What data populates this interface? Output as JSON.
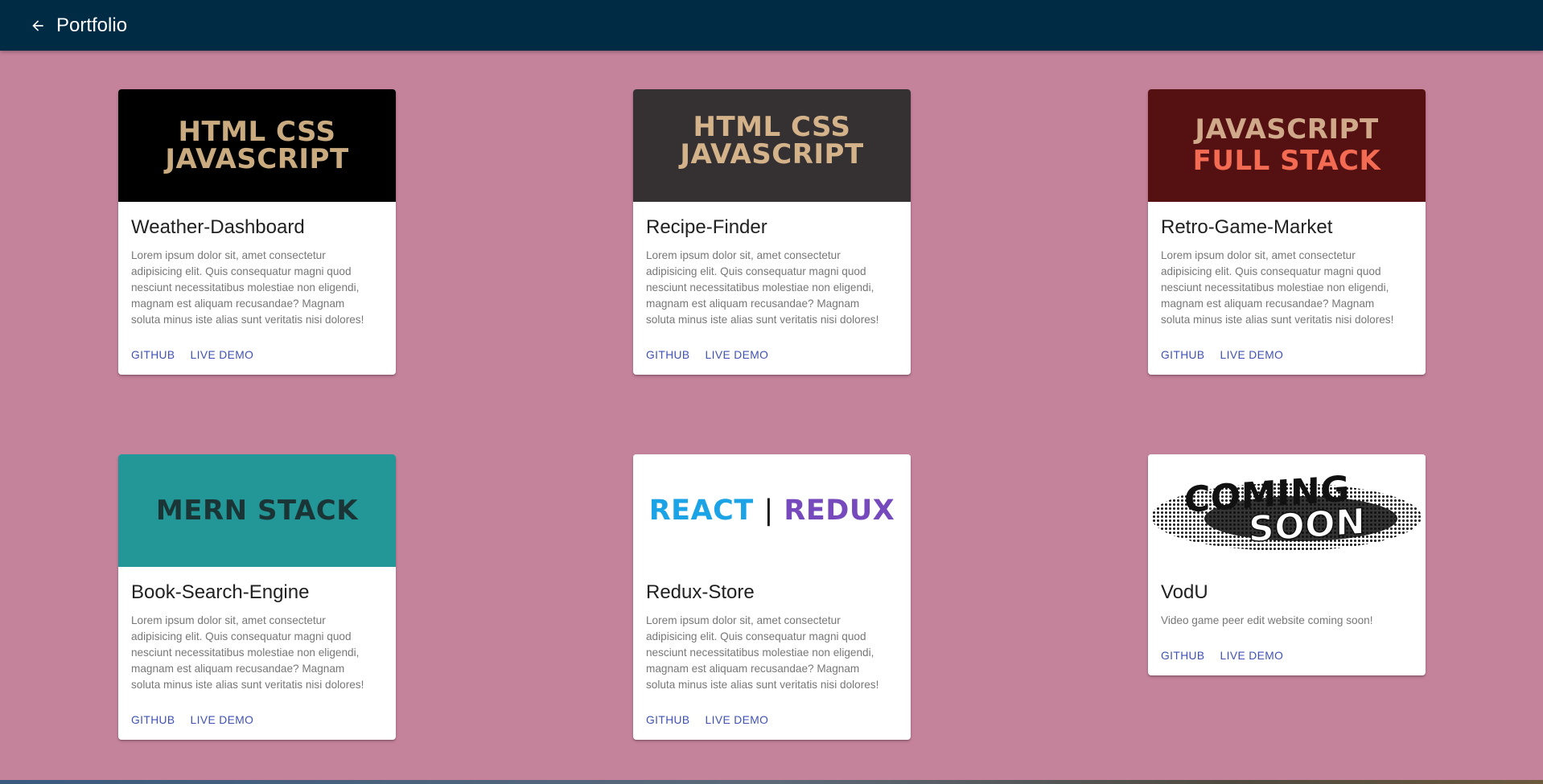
{
  "appbar": {
    "title": "Portfolio",
    "back_icon": "arrow-left-icon",
    "background": "#002b45"
  },
  "page": {
    "background": "#c5829b"
  },
  "actions": {
    "github_label": "GITHUB",
    "demo_label": "LIVE DEMO",
    "color": "#3f51b5"
  },
  "cards": [
    {
      "title": "Weather-Dashboard",
      "image_lines": [
        "HTML CSS",
        "JAVASCRIPT"
      ],
      "image_bg": "#000000",
      "image_fg": "#c9ab7f",
      "description": "Lorem ipsum dolor sit, amet consectetur\nadipisicing elit. Quis consequatur magni quod\nnesciunt necessitatibus molestiae non eligendi,\nmagnam est aliquam recusandae? Magnam\nsoluta minus iste alias sunt veritatis nisi dolores!"
    },
    {
      "title": "Recipe-Finder",
      "image_lines": [
        "HTML CSS",
        "JAVASCRIPT"
      ],
      "image_bg": "#353132",
      "image_fg": "#d4b38a",
      "description": "Lorem ipsum dolor sit, amet consectetur\nadipisicing elit. Quis consequatur magni quod\nnesciunt necessitatibus molestiae non eligendi,\nmagnam est aliquam recusandae? Magnam\nsoluta minus iste alias sunt veritatis nisi dolores!"
    },
    {
      "title": "Retro-Game-Market",
      "image_lines": [
        "JAVASCRIPT",
        "FULL STACK"
      ],
      "image_bg": "#551012",
      "image_fg": "#d0a98a",
      "image_fg2": "#f36b52",
      "description": "Lorem ipsum dolor sit, amet consectetur\nadipisicing elit. Quis consequatur magni quod\nnesciunt necessitatibus molestiae non eligendi,\nmagnam est aliquam recusandae? Magnam\nsoluta minus iste alias sunt veritatis nisi dolores!"
    },
    {
      "title": "Book-Search-Engine",
      "image_lines": [
        "MERN STACK"
      ],
      "image_bg": "#239797",
      "image_fg": "#1b3536",
      "description": "Lorem ipsum dolor sit, amet consectetur\nadipisicing elit. Quis consequatur magni quod\nnesciunt necessitatibus molestiae non eligendi,\nmagnam est aliquam recusandae? Magnam\nsoluta minus iste alias sunt veritatis nisi dolores!"
    },
    {
      "title": "Redux-Store",
      "image_words": [
        "REACT",
        "|",
        "REDUX"
      ],
      "image_bg": "#ffffff",
      "image_colors": [
        "#1ba3e6",
        "#111111",
        "#764abc"
      ],
      "description": "Lorem ipsum dolor sit, amet consectetur\nadipisicing elit. Quis consequatur magni quod\nnesciunt necessitatibus molestiae non eligendi,\nmagnam est aliquam recusandae? Magnam\nsoluta minus iste alias sunt veritatis nisi dolores!"
    },
    {
      "title": "VodU",
      "image_lines": [
        "COMING",
        "SOON"
      ],
      "image_bg": "#ffffff",
      "image_fg": "#111111",
      "description": "Video game peer edit website coming soon!"
    }
  ]
}
